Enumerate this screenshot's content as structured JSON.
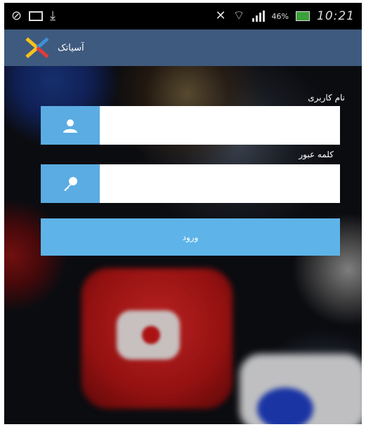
{
  "status_bar": {
    "clock": "10:21",
    "battery_pct": "46%",
    "icons": [
      "mute-icon",
      "image-icon",
      "download-icon",
      "vibrate-icon",
      "wifi-icon",
      "signal-icon",
      "battery-icon"
    ]
  },
  "app_bar": {
    "title": "آسیاتک",
    "logo": "asiatech-logo"
  },
  "form": {
    "username_label": "نام کاربری",
    "username_value": "",
    "username_icon": "user-icon",
    "password_label": "کلمه عبور",
    "password_value": "",
    "password_icon": "key-icon",
    "login_label": "ورود"
  },
  "colors": {
    "app_bar": "#3e5a7e",
    "icon_box": "#5aace2",
    "button": "#5eb4e8"
  }
}
